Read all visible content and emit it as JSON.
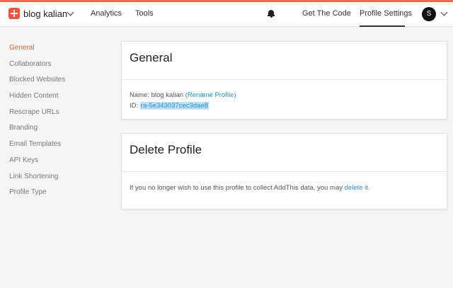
{
  "header": {
    "profile_name": "blog kalian",
    "nav": {
      "analytics": "Analytics",
      "tools": "Tools",
      "get_code": "Get The Code",
      "profile_settings": "Profile Settings"
    },
    "avatar_initial": "S"
  },
  "sidebar": {
    "items": [
      {
        "label": "General",
        "active": true
      },
      {
        "label": "Collaborators"
      },
      {
        "label": "Blocked Websites"
      },
      {
        "label": "Hidden Content"
      },
      {
        "label": "Rescrape URLs"
      },
      {
        "label": "Branding"
      },
      {
        "label": "Email Templates"
      },
      {
        "label": "API Keys"
      },
      {
        "label": "Link Shortening"
      },
      {
        "label": "Profile Type"
      }
    ]
  },
  "general": {
    "title": "General",
    "name_label": "Name: ",
    "name_value": "blog kalian",
    "rename_link": "(Rename Profile)",
    "id_label": "ID: ",
    "id_value": "ra-5e343037cec3dae8"
  },
  "delete_profile": {
    "title": "Delete Profile",
    "text": "If you no longer wish to use this profile to collect AddThis data, you may ",
    "link": "delete it",
    "suffix": "."
  },
  "colors": {
    "accent": "#f26a3d",
    "link": "#2a8fc7",
    "active_nav": "#ef5d2e"
  }
}
